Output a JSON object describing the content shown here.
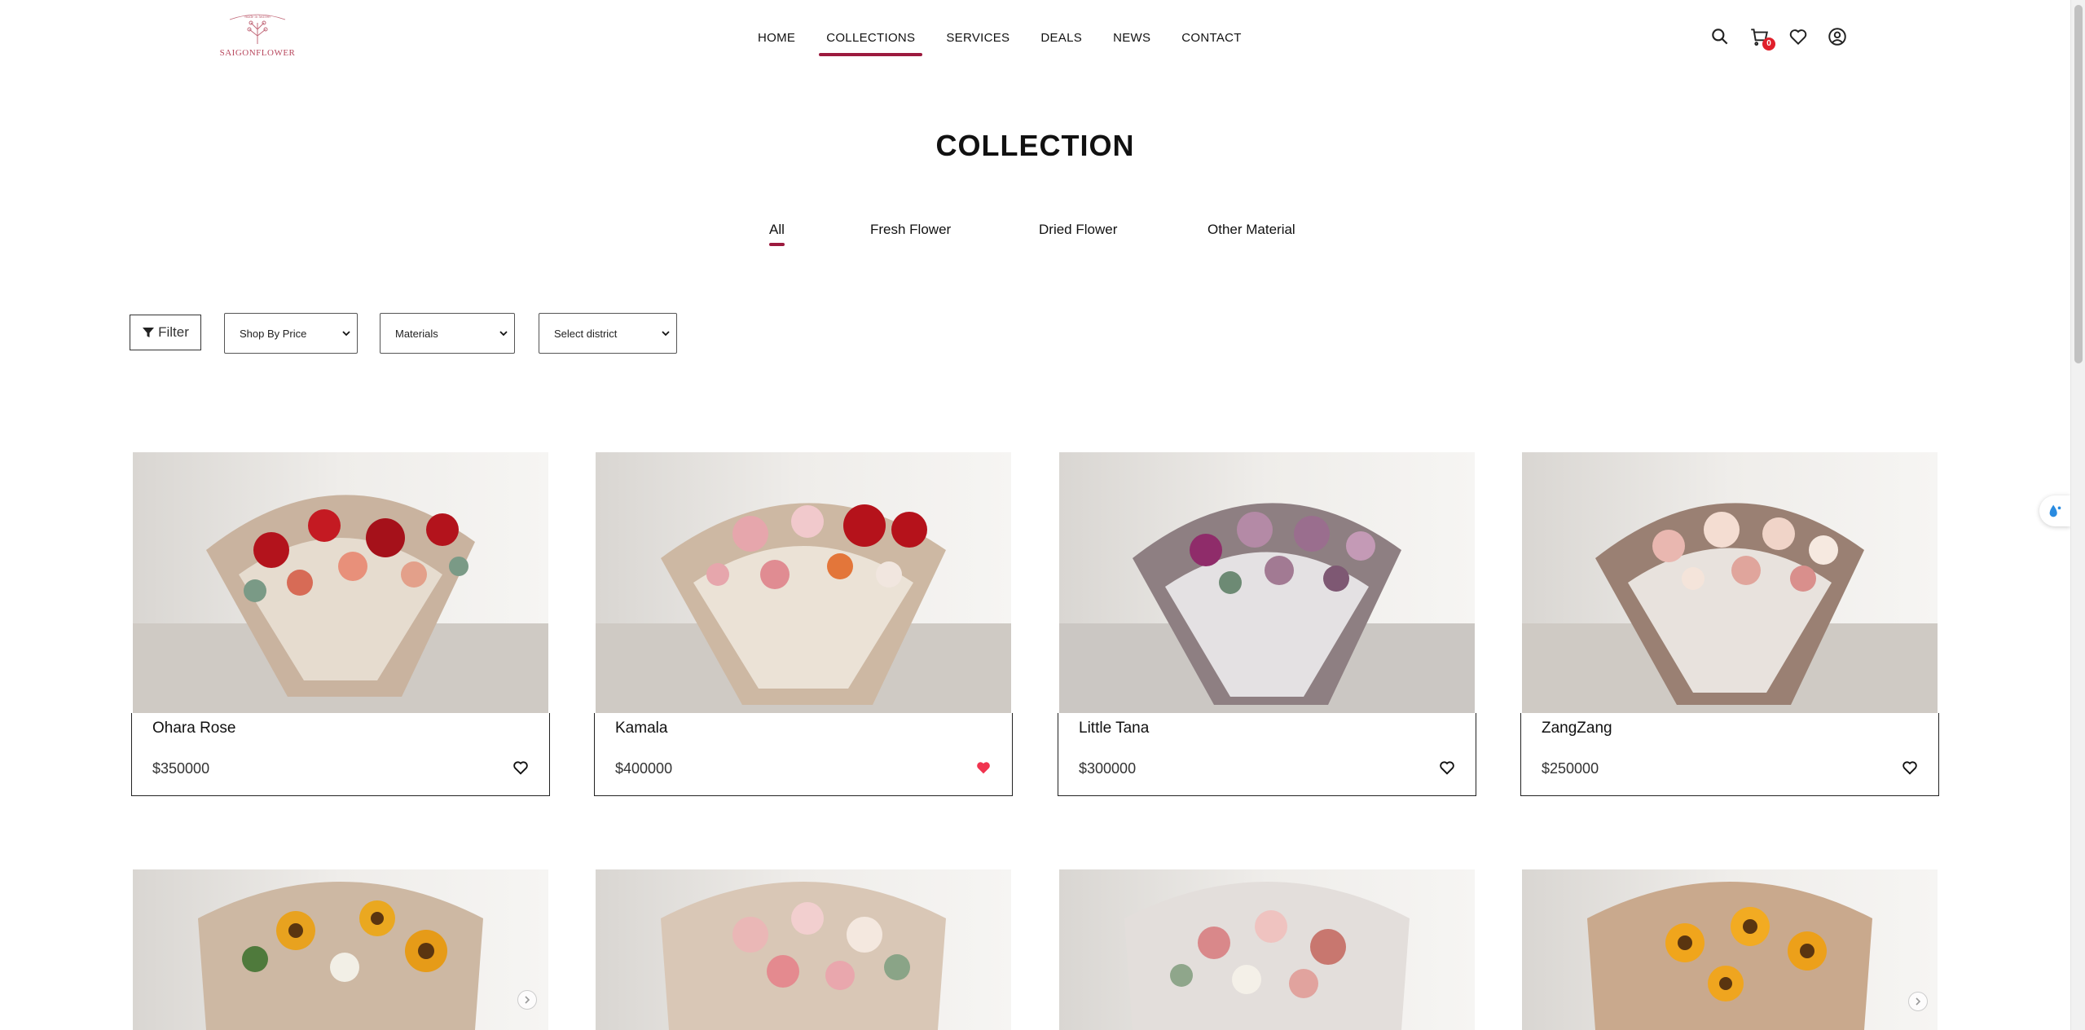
{
  "brand": {
    "logo_text": "SAIGONFLOWER",
    "logo_tagline": "made in heaven",
    "brand_color": "#9c1a3e"
  },
  "nav": {
    "items": [
      {
        "label": "HOME"
      },
      {
        "label": "COLLECTIONS",
        "active": true
      },
      {
        "label": "SERVICES"
      },
      {
        "label": "DEALS"
      },
      {
        "label": "NEWS"
      },
      {
        "label": "CONTACT"
      }
    ]
  },
  "header_icons": {
    "search": "search-icon",
    "cart": "cart-icon",
    "cart_count": "0",
    "wishlist": "heart-icon",
    "account": "user-icon"
  },
  "page": {
    "title": "COLLECTION"
  },
  "tabs": [
    {
      "label": "All",
      "active": true
    },
    {
      "label": "Fresh Flower"
    },
    {
      "label": "Dried Flower"
    },
    {
      "label": "Other Material"
    }
  ],
  "filters": {
    "filter_label": "Filter",
    "price_select": "Shop By Price",
    "materials_select": "Materials",
    "district_select": "Select district"
  },
  "products": [
    {
      "name": "Ohara Rose",
      "price": "$350000",
      "liked": false
    },
    {
      "name": "Kamala",
      "price": "$400000",
      "liked": true
    },
    {
      "name": "Little Tana",
      "price": "$300000",
      "liked": false
    },
    {
      "name": "ZangZang",
      "price": "$250000",
      "liked": false
    }
  ],
  "colors": {
    "accent": "#9c1a3e",
    "liked_heart": "#f0344f",
    "badge": "#e0202b"
  }
}
